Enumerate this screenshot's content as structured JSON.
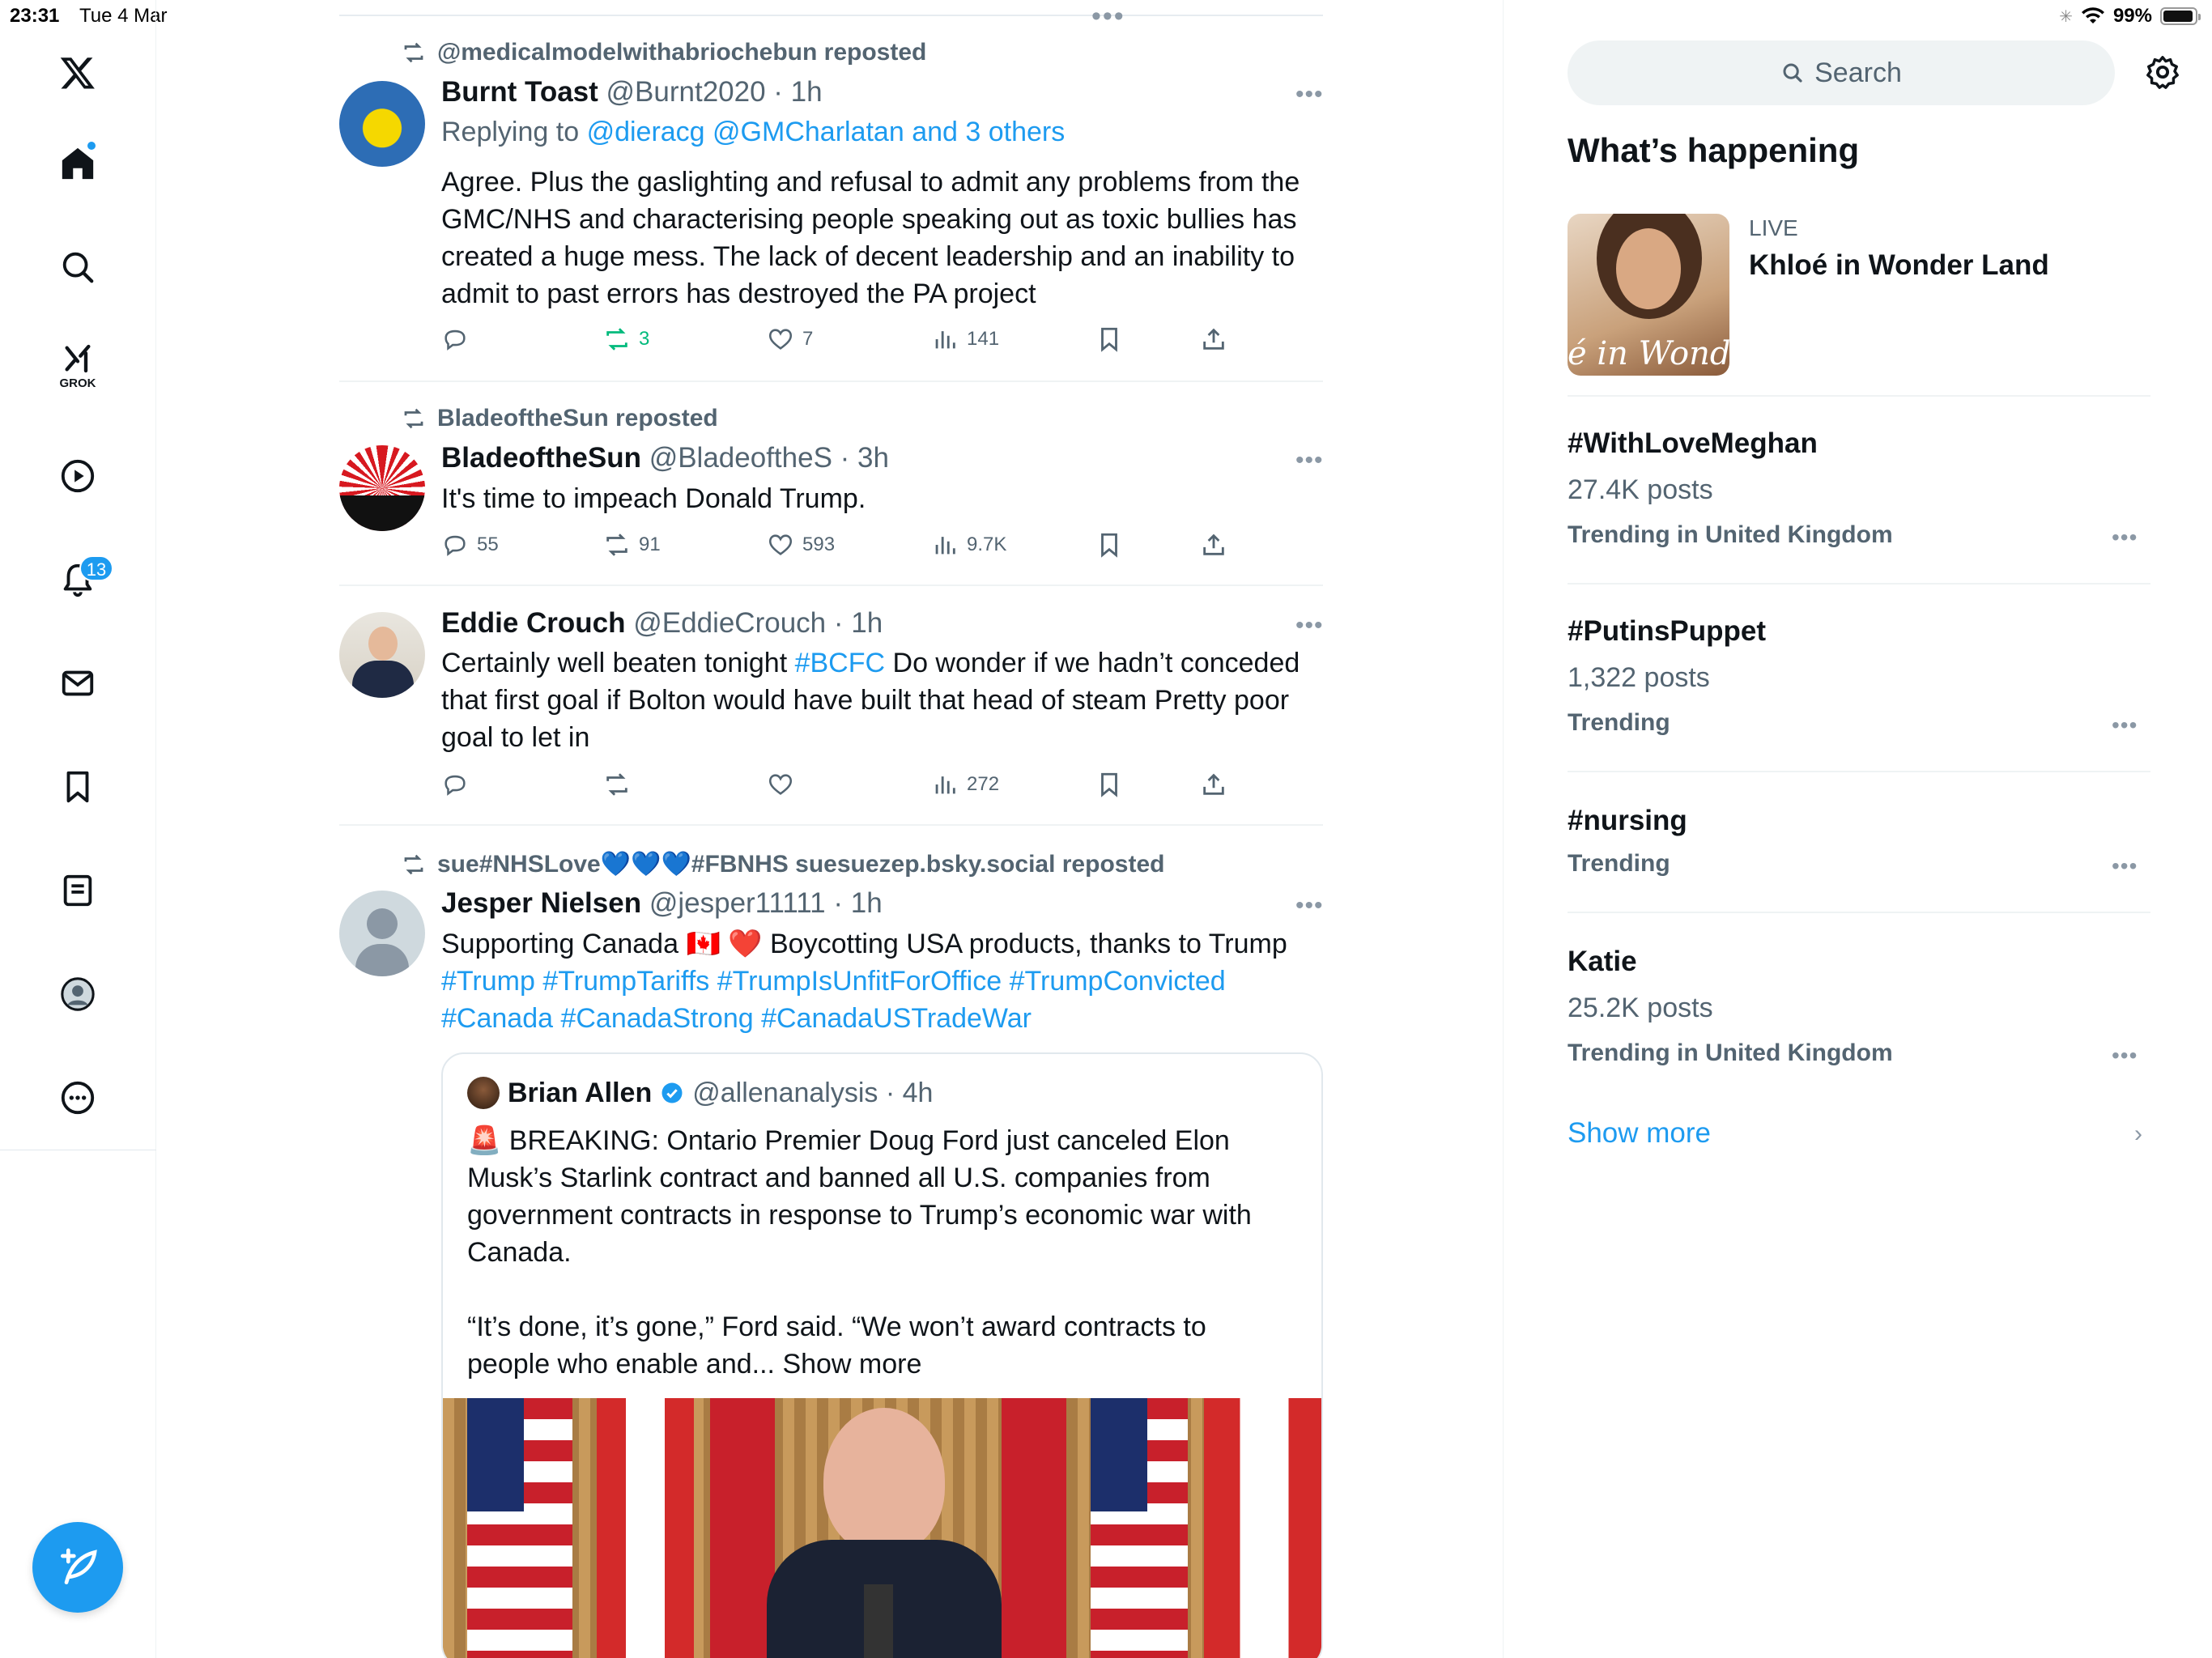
{
  "status": {
    "time": "23:31",
    "date": "Tue 4 Mar",
    "battery": "99%"
  },
  "nav": {
    "grok_label": "GROK",
    "notifications_badge": "13"
  },
  "tweets": [
    {
      "repost_by": "@medicalmodelwithabriochebun reposted",
      "name": "Burnt Toast",
      "handle": "@Burnt2020 · 1h",
      "replying_prefix": "Replying to",
      "replying_to": "@dieracg @GMCharlatan and 3 others",
      "text": "Agree. Plus the gaslighting and refusal to admit any problems from the GMC/NHS and characterising people speaking out as toxic bullies has created a huge mess. The lack of decent leadership and an inability to admit to past errors has destroyed the PA project",
      "reposts": "3",
      "likes": "7",
      "views": "141"
    },
    {
      "repost_by": "BladeoftheSun reposted",
      "name": "BladeoftheSun",
      "handle": "@BladeoftheS · 3h",
      "text": "It's time to impeach Donald Trump.",
      "replies": "55",
      "reposts": "91",
      "likes": "593",
      "views": "9.7K"
    },
    {
      "name": "Eddie Crouch",
      "handle": "@EddieCrouch · 1h",
      "text_before": "Certainly well beaten tonight ",
      "hashtag": "#BCFC",
      "text_after": " Do wonder if we hadn’t conceded that first goal if Bolton would have built that head of steam Pretty poor goal to let in",
      "views": "272"
    },
    {
      "repost_by": "sue#NHSLove💙💙💙#FBNHS suesuezep.bsky.social reposted",
      "name": "Jesper Nielsen",
      "handle": "@jesper11111 · 1h",
      "text": "Supporting Canada 🇨🇦 ❤️  Boycotting USA products, thanks to Trump",
      "hashtags": "#Trump #TrumpTariffs #TrumpIsUnfitForOffice #TrumpConvicted #Canada #CanadaStrong #CanadaUSTradeWar",
      "quote": {
        "name": "Brian Allen",
        "handle": "@allenanalysis · 4h",
        "text1": "🚨 BREAKING: Ontario Premier Doug Ford just canceled Elon Musk’s Starlink contract and banned all U.S. companies from government contracts in response to Trump’s economic war with Canada.",
        "text2": "“It’s done, it’s gone,” Ford said. “We won’t award contracts to people who enable and...",
        "show_more": "Show more"
      }
    }
  ],
  "sidebar": {
    "search_placeholder": "Search",
    "title": "What’s happening",
    "live": {
      "label": "LIVE",
      "title": "Khloé in Wonder Land",
      "thumb_text": "é in Wonder L"
    },
    "trends": [
      {
        "title": "#WithLoveMeghan",
        "posts": "27.4K posts",
        "context": "Trending in United Kingdom"
      },
      {
        "title": "#PutinsPuppet",
        "posts": "1,322 posts",
        "context": "Trending"
      },
      {
        "title": "#nursing",
        "posts": "",
        "context": "Trending"
      },
      {
        "title": "Katie",
        "posts": "25.2K posts",
        "context": "Trending in United Kingdom"
      }
    ],
    "show_more": "Show more"
  }
}
